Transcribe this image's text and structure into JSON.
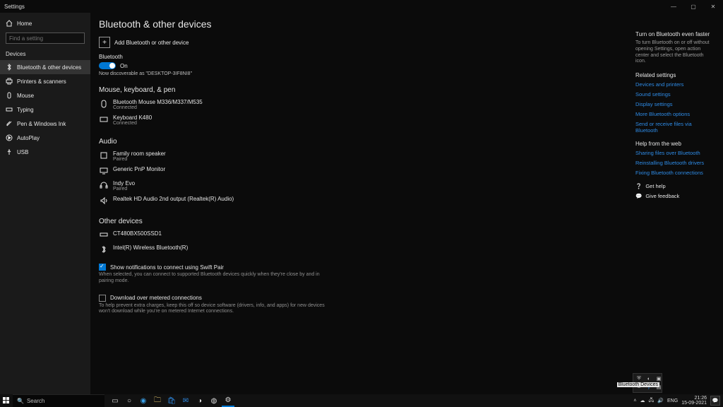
{
  "window": {
    "title": "Settings",
    "minimize": "—",
    "maximize": "▢",
    "close": "✕"
  },
  "sidebar": {
    "home": "Home",
    "search_placeholder": "Find a setting",
    "heading": "Devices",
    "items": [
      {
        "label": "Bluetooth & other devices",
        "icon": "bluetooth"
      },
      {
        "label": "Printers & scanners",
        "icon": "printer"
      },
      {
        "label": "Mouse",
        "icon": "mouse"
      },
      {
        "label": "Typing",
        "icon": "typing"
      },
      {
        "label": "Pen & Windows Ink",
        "icon": "pen"
      },
      {
        "label": "AutoPlay",
        "icon": "autoplay"
      },
      {
        "label": "USB",
        "icon": "usb"
      }
    ]
  },
  "page": {
    "title": "Bluetooth & other devices",
    "add_device": "Add Bluetooth or other device",
    "bluetooth_label": "Bluetooth",
    "toggle_state": "On",
    "discover_text": "Now discoverable as \"DESKTOP-3IF8NI8\""
  },
  "sections": {
    "mouse": {
      "title": "Mouse, keyboard, & pen",
      "devices": [
        {
          "name": "Bluetooth Mouse M336/M337/M535",
          "status": "Connected",
          "icon": "mouse"
        },
        {
          "name": "Keyboard K480",
          "status": "Connected",
          "icon": "keyboard"
        }
      ]
    },
    "audio": {
      "title": "Audio",
      "devices": [
        {
          "name": "Family room speaker",
          "status": "Paired",
          "icon": "speaker"
        },
        {
          "name": "Generic PnP Monitor",
          "status": "",
          "icon": "monitor"
        },
        {
          "name": "Indy Evo",
          "status": "Paired",
          "icon": "headphone"
        },
        {
          "name": "Realtek HD Audio 2nd output (Realtek(R) Audio)",
          "status": "",
          "icon": "audio"
        }
      ]
    },
    "other": {
      "title": "Other devices",
      "devices": [
        {
          "name": "CT480BX500SSD1",
          "status": "",
          "icon": "drive"
        },
        {
          "name": "Intel(R) Wireless Bluetooth(R)",
          "status": "",
          "icon": "bluetooth"
        }
      ]
    }
  },
  "options": {
    "swift_pair": {
      "label": "Show notifications to connect using Swift Pair",
      "help": "When selected, you can connect to supported Bluetooth devices quickly when they're close by and in pairing mode."
    },
    "metered": {
      "label": "Download over metered connections",
      "help": "To help prevent extra charges, keep this off so device software (drivers, info, and apps) for new devices won't download while you're on metered Internet connections."
    }
  },
  "right": {
    "faster": {
      "title": "Turn on Bluetooth even faster",
      "body": "To turn Bluetooth on or off without opening Settings, open action center and select the Bluetooth icon."
    },
    "related": {
      "title": "Related settings",
      "links": [
        "Devices and printers",
        "Sound settings",
        "Display settings",
        "More Bluetooth options",
        "Send or receive files via Bluetooth"
      ]
    },
    "help": {
      "title": "Help from the web",
      "links": [
        "Sharing files over Bluetooth",
        "Reinstalling Bluetooth drivers",
        "Fixing Bluetooth connections"
      ]
    },
    "get_help": "Get help",
    "feedback": "Give feedback"
  },
  "taskbar": {
    "search_placeholder": "Search",
    "lang": "ENG",
    "time": "21:26",
    "date": "15-09-2021",
    "tooltip": "Bluetooth Devices"
  }
}
